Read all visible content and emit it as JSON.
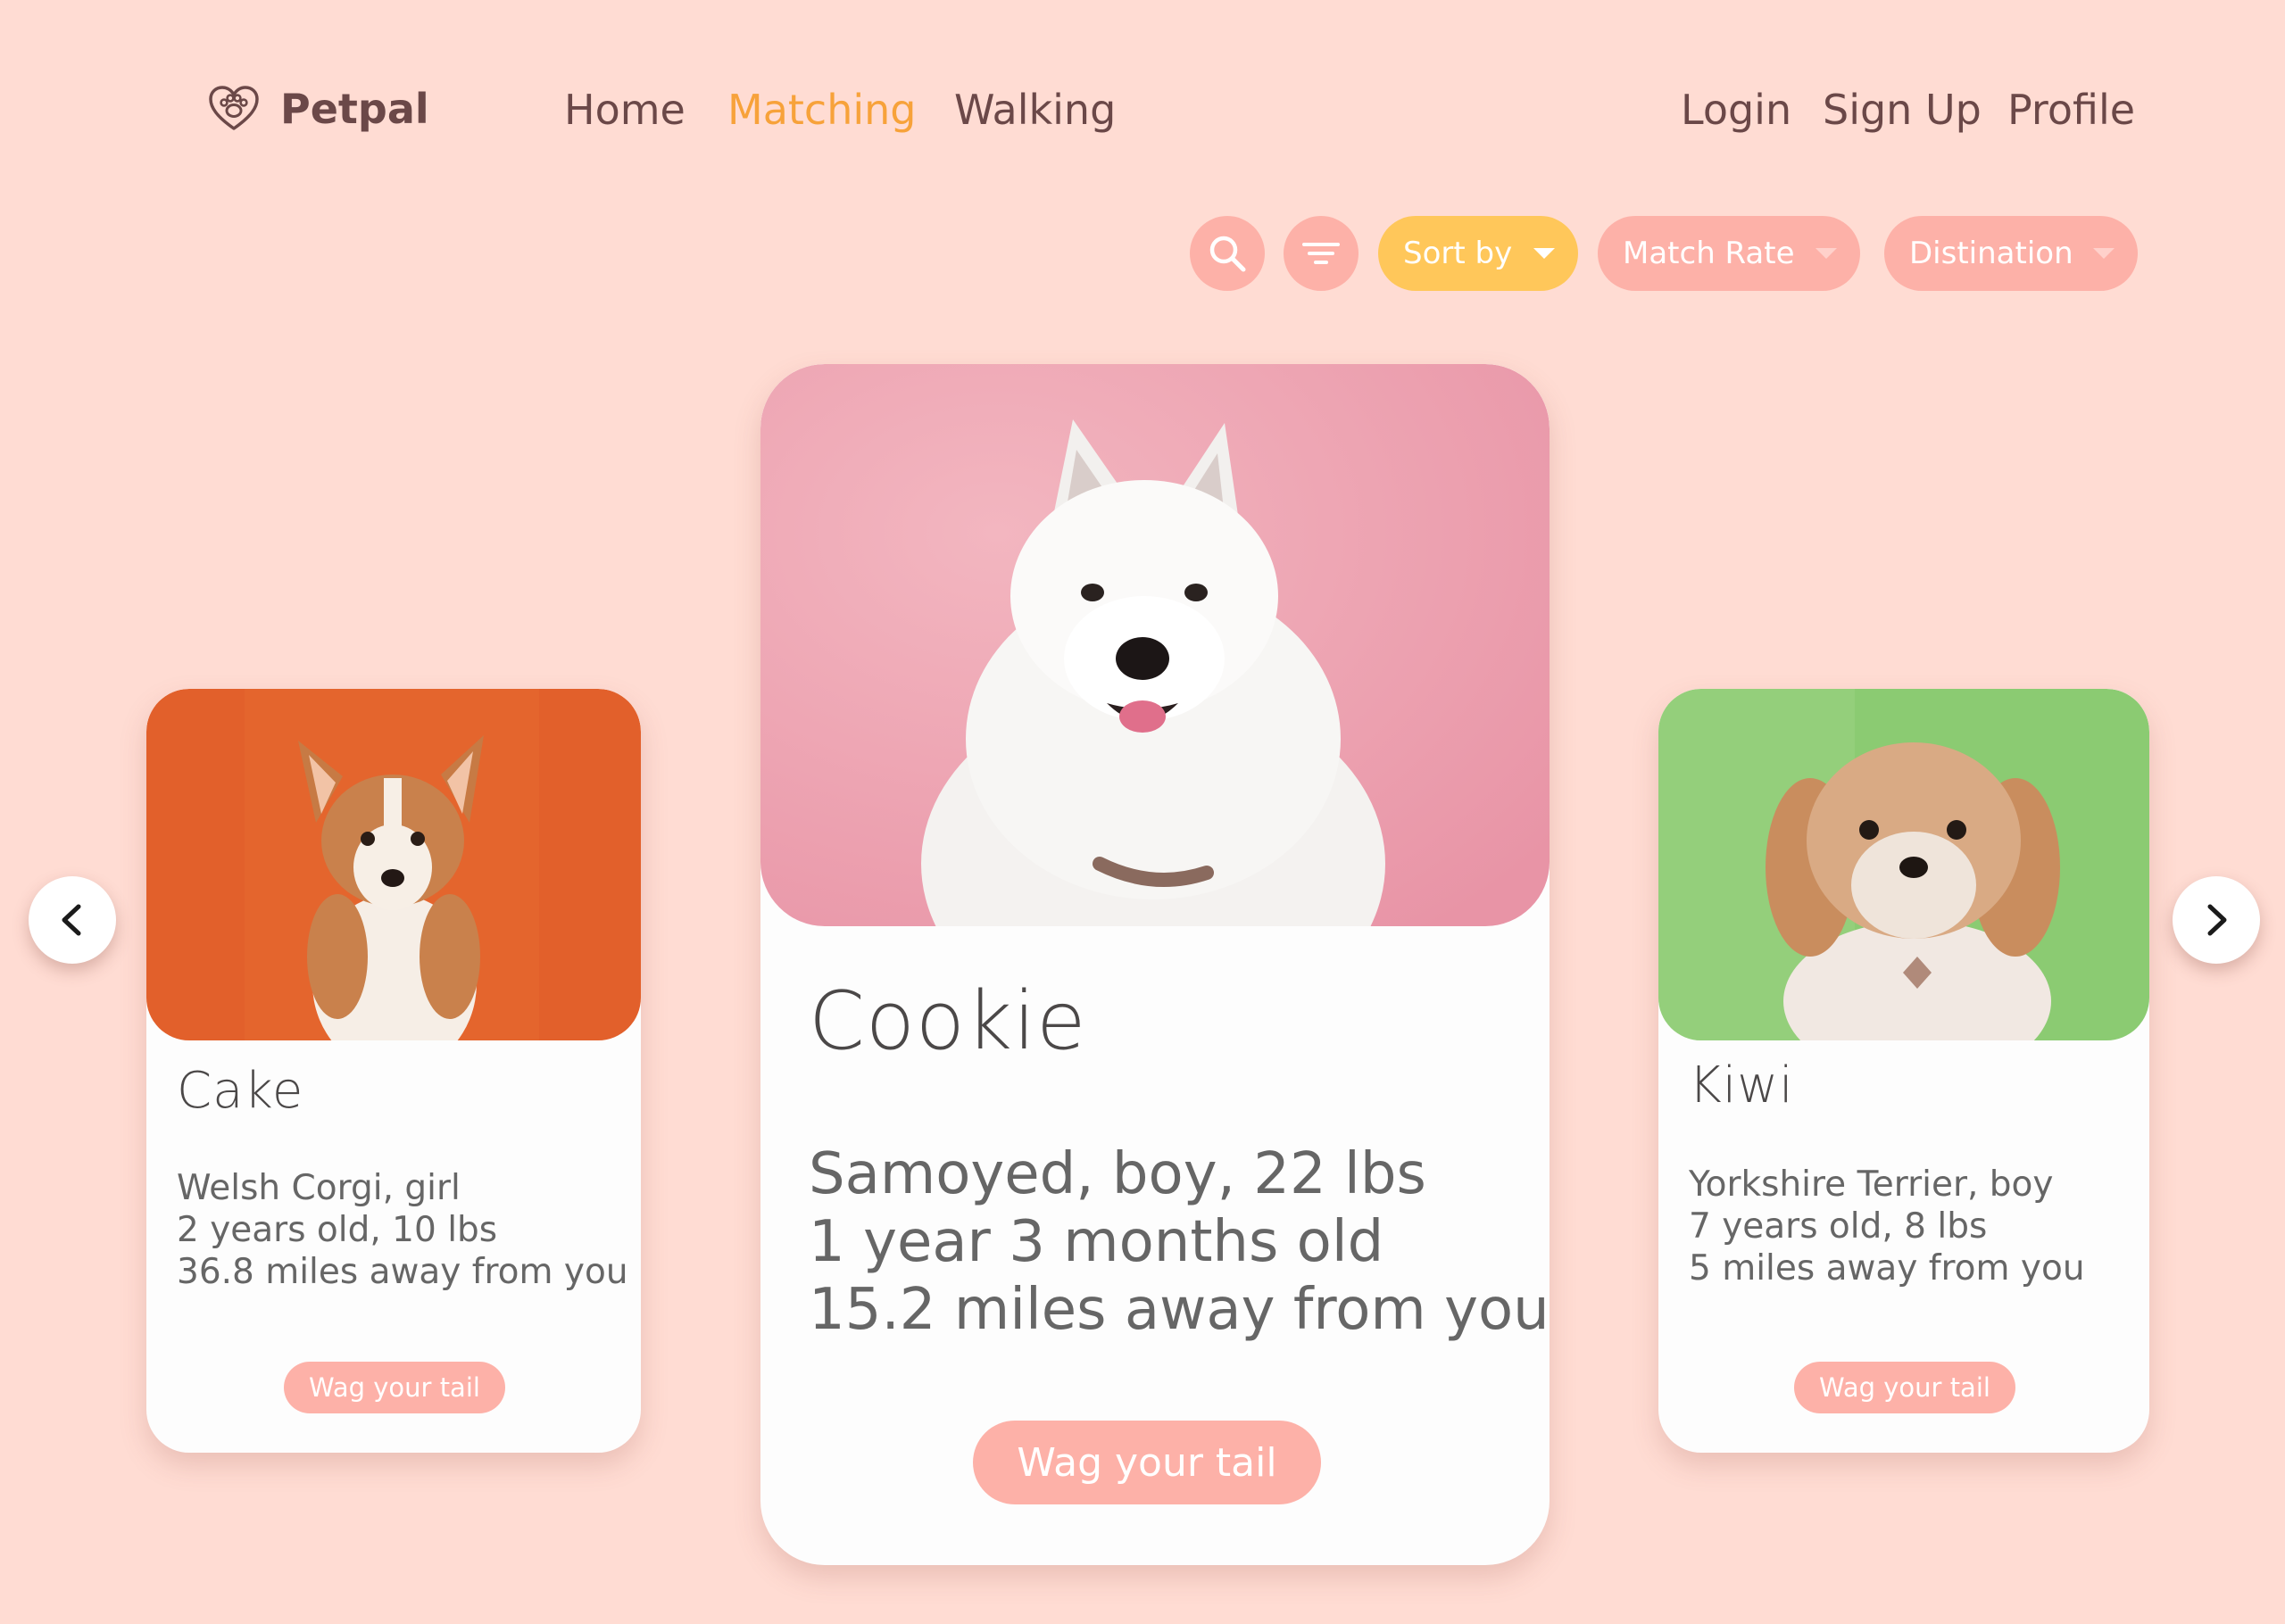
{
  "brand": {
    "name": "Petpal",
    "logo_icon": "heart-paw-icon"
  },
  "nav": {
    "home": "Home",
    "matching": "Matching",
    "walking": "Walking",
    "login": "Login",
    "signup": "Sign Up",
    "profile": "Profile",
    "active": "Matching"
  },
  "toolbar": {
    "search_icon": "search-icon",
    "filter_icon": "filter-icon",
    "sort_label": "Sort by",
    "match_rate_label": "Match Rate",
    "destination_label": "Distination"
  },
  "carousel": {
    "prev_icon": "chevron-left-icon",
    "next_icon": "chevron-right-icon",
    "cards": [
      {
        "name": "Cake",
        "breed_line": "Welsh Corgi, girl",
        "age_line": "2 years old, 10 lbs",
        "distance_line": "36.8 miles away from you",
        "button": "Wag your tail",
        "photo_bg": "#e2602b"
      },
      {
        "name": "Cookie",
        "breed_line": "Samoyed, boy, 22 lbs",
        "age_line": "1 year 3 months old",
        "distance_line": "15.2 miles away from you",
        "button": "Wag your tail",
        "photo_bg": "#ee9fad"
      },
      {
        "name": "Kiwi",
        "breed_line": "Yorkshire Terrier, boy",
        "age_line": "7 years old, 8 lbs",
        "distance_line": "5 miles away from you",
        "button": "Wag your tail",
        "photo_bg": "#8bcb72"
      }
    ]
  },
  "colors": {
    "background": "#ffdcd3",
    "accent": "#f7a23a",
    "pill": "#fdb1a8",
    "sort_pill": "#ffc75a",
    "text": "#6b4848"
  }
}
